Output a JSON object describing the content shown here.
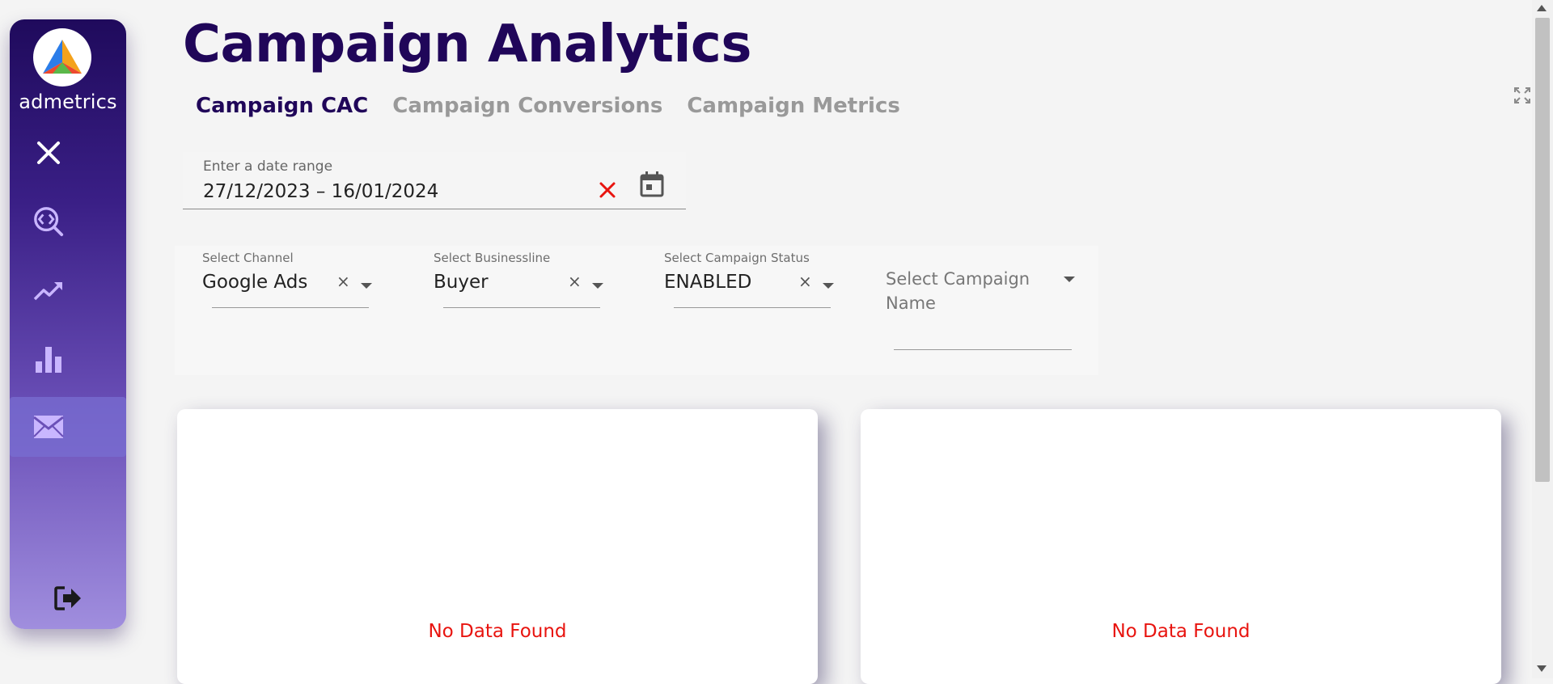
{
  "app": {
    "brand": "admetrics",
    "title": "Campaign Analytics"
  },
  "tabs": [
    {
      "label": "Campaign CAC",
      "active": true
    },
    {
      "label": "Campaign Conversions",
      "active": false
    },
    {
      "label": "Campaign Metrics",
      "active": false
    }
  ],
  "date_range": {
    "label": "Enter a date range",
    "value": "27/12/2023 – 16/01/2024"
  },
  "filters": {
    "channel": {
      "label": "Select Channel",
      "value": "Google Ads"
    },
    "businessline": {
      "label": "Select Businessline",
      "value": "Buyer"
    },
    "status": {
      "label": "Select Campaign Status",
      "value": "ENABLED"
    },
    "campaign_name": {
      "placeholder": "Select Campaign Name"
    },
    "clear_glyph": "×"
  },
  "charts": [
    {
      "message": "No Data Found"
    },
    {
      "message": "No Data Found"
    }
  ],
  "sidebar": {
    "items": [
      {
        "icon": "close-icon"
      },
      {
        "icon": "code-search-icon"
      },
      {
        "icon": "trending-up-icon"
      },
      {
        "icon": "bar-chart-icon"
      },
      {
        "icon": "mail-icon",
        "active": true
      },
      {
        "icon": "logout-icon"
      }
    ]
  },
  "colors": {
    "brand_dark": "#200659",
    "tab_inactive": "#999999",
    "error": "#e8140f",
    "sidebar_top": "#1f0a5c",
    "sidebar_bottom": "#a08ede",
    "icon_lavender": "#c9b6ff"
  }
}
